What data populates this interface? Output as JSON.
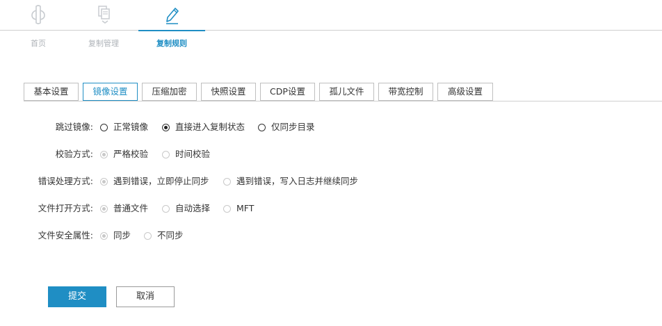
{
  "nav": {
    "items": [
      {
        "label": "首页",
        "icon": "home-icon"
      },
      {
        "label": "复制管理",
        "icon": "copy-management-icon"
      },
      {
        "label": "复制规则",
        "icon": "edit-pencil-icon"
      }
    ],
    "active_index": 2
  },
  "tabs": [
    "基本设置",
    "镜像设置",
    "压缩加密",
    "快照设置",
    "CDP设置",
    "孤儿文件",
    "带宽控制",
    "高级设置"
  ],
  "active_tab": "镜像设置",
  "form": {
    "rows": [
      {
        "label": "跳过镜像:",
        "options": [
          "正常镜像",
          "直接进入复制状态",
          "仅同步目录"
        ],
        "selected": "直接进入复制状态",
        "disabled": false
      },
      {
        "label": "校验方式:",
        "options": [
          "严格校验",
          "时间校验"
        ],
        "selected": "严格校验",
        "disabled": true
      },
      {
        "label": "错误处理方式:",
        "options": [
          "遇到错误，立即停止同步",
          "遇到错误，写入日志并继续同步"
        ],
        "selected": "遇到错误，立即停止同步",
        "disabled": true
      },
      {
        "label": "文件打开方式:",
        "options": [
          "普通文件",
          "自动选择",
          "MFT"
        ],
        "selected": "普通文件",
        "disabled": true
      },
      {
        "label": "文件安全属性:",
        "options": [
          "同步",
          "不同步"
        ],
        "selected": "同步",
        "disabled": true
      }
    ]
  },
  "buttons": {
    "submit": "提交",
    "cancel": "取消"
  },
  "colors": {
    "accent": "#1f8ec4",
    "nav_inactive": "#aeb3b8",
    "disabled_radio": "#c9c9c9"
  }
}
